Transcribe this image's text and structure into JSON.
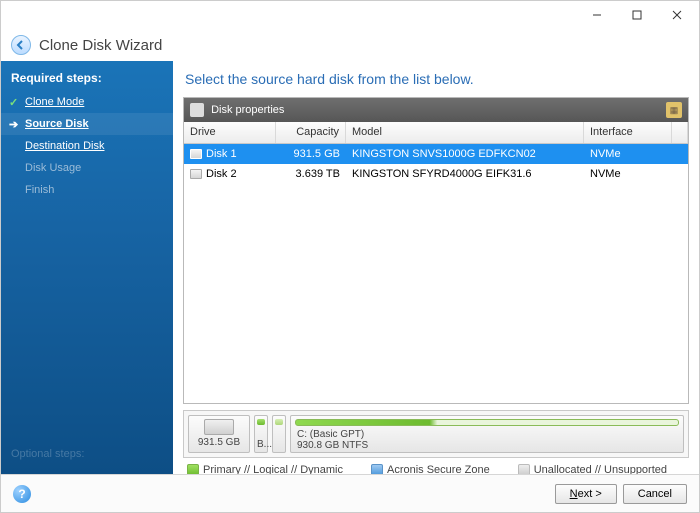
{
  "window": {
    "title": "Clone Disk Wizard"
  },
  "sidebar": {
    "section": "Required steps:",
    "steps": [
      {
        "label": "Clone Mode",
        "state": "done"
      },
      {
        "label": "Source Disk",
        "state": "active"
      },
      {
        "label": "Destination Disk",
        "state": "pending"
      },
      {
        "label": "Disk Usage",
        "state": "disabled"
      },
      {
        "label": "Finish",
        "state": "disabled"
      }
    ],
    "optional_label": "Optional steps:"
  },
  "main": {
    "heading": "Select the source hard disk from the list below.",
    "panel_title": "Disk properties",
    "columns": {
      "drive": "Drive",
      "capacity": "Capacity",
      "model": "Model",
      "interface": "Interface"
    },
    "disks": [
      {
        "drive": "Disk 1",
        "capacity": "931.5 GB",
        "model": "KINGSTON SNVS1000G EDFKCN02",
        "interface": "NVMe",
        "selected": true
      },
      {
        "drive": "Disk 2",
        "capacity": "3.639 TB",
        "model": "KINGSTON SFYRD4000G EIFK31.6",
        "interface": "NVMe",
        "selected": false
      }
    ],
    "diskmap": {
      "total": "931.5 GB",
      "tiny_label": "B...",
      "main_label": "C: (Basic GPT)",
      "main_size": "930.8 GB  NTFS"
    },
    "legend": {
      "primary": "Primary // Logical // Dynamic",
      "secure": "Acronis Secure Zone",
      "unalloc": "Unallocated // Unsupported"
    }
  },
  "footer": {
    "next": "Next >",
    "cancel": "Cancel"
  }
}
